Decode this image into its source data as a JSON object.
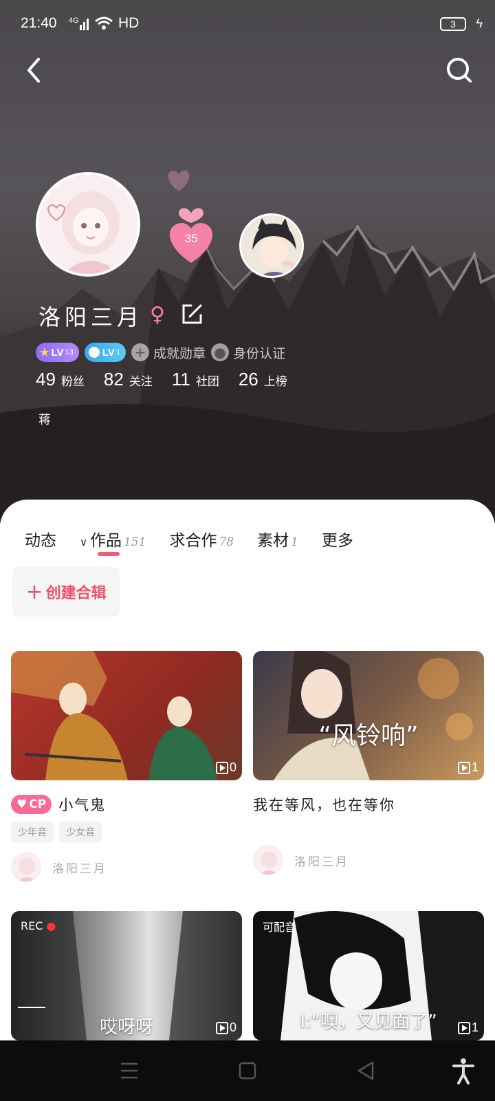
{
  "status_bar": {
    "time": "21:40",
    "network": "4G",
    "hd": "HD",
    "battery": "3"
  },
  "header": {
    "back_icon": "back-arrow-icon",
    "search_icon": "search-icon"
  },
  "profile": {
    "heart_count": "35",
    "username": "洛阳三月",
    "gender": "♀",
    "badges": {
      "lv_primary": "LV",
      "lv_primary_num": "13",
      "lv_secondary": "LV",
      "lv_secondary_num": "1",
      "achievement": "成就勋章",
      "identity": "身份认证"
    },
    "stats": [
      {
        "num": "49",
        "label": "粉丝"
      },
      {
        "num": "82",
        "label": "关注"
      },
      {
        "num": "11",
        "label": "社团"
      },
      {
        "num": "26",
        "label": "上榜"
      }
    ],
    "bio": "蒋"
  },
  "tabs": [
    {
      "label": "动态",
      "count": ""
    },
    {
      "label": "作品",
      "count": "151",
      "active": true
    },
    {
      "label": "求合作",
      "count": "78"
    },
    {
      "label": "素材",
      "count": "1"
    },
    {
      "label": "更多",
      "count": ""
    }
  ],
  "create_album": "创建合辑",
  "cards": [
    {
      "title": "小气鬼",
      "cp_label": "CP",
      "tags": [
        "少年音",
        "少女音"
      ],
      "author": "洛阳三月",
      "plays": "0"
    },
    {
      "title": "我在等风，也在等你",
      "overlay": "“风铃响”",
      "author": "洛阳三月",
      "plays": "1"
    },
    {
      "overlay": "哎呀呀",
      "rec": "REC",
      "plays": "0"
    },
    {
      "overlay": "I:“噢，又见面了”",
      "corner": "可配音",
      "plays": "1"
    }
  ],
  "colors": {
    "accent": "#f25b78",
    "cp_pink": "#f96a95",
    "lv_purple": "#8b6cf5",
    "lv_blue": "#3aa7f0"
  }
}
